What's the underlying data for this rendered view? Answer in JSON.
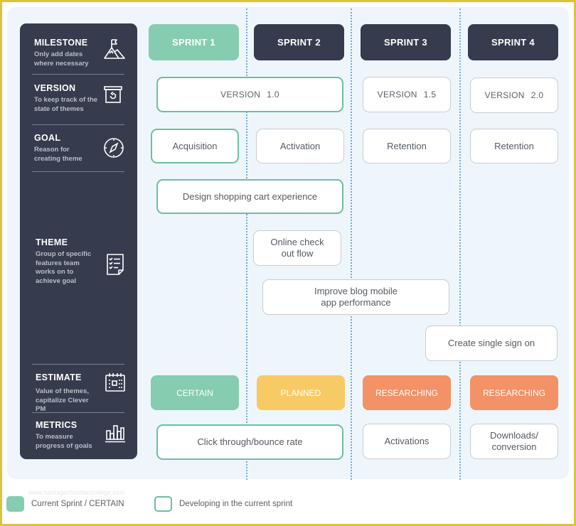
{
  "colors": {
    "sidebar_bg": "#363c4e",
    "current_green": "#86ccb0",
    "current_border": "#6dbf9c",
    "planned_yellow": "#f7ca65",
    "researching_orange": "#f39167",
    "canvas_bg": "#eef6fc",
    "frame_yellow": "#e0c23a"
  },
  "sidebar": {
    "sections": [
      {
        "title": "MILESTONE",
        "desc": "Only add dates where necessary",
        "icon": "mountain-flag-icon"
      },
      {
        "title": "VERSION",
        "desc": "To keep track of the state of themes",
        "icon": "archive-restore-icon"
      },
      {
        "title": "GOAL",
        "desc": "Reason for creating theme",
        "icon": "compass-icon"
      },
      {
        "title": "THEME",
        "desc": "Group of specific features team works on to achieve goal",
        "icon": "checklist-icon"
      },
      {
        "title": "ESTIMATE",
        "desc": "Value of themes, capitalize Clever PM",
        "icon": "calendar-icon"
      },
      {
        "title": "METRICS",
        "desc": "To measure progress of goals",
        "icon": "bar-chart-icon"
      }
    ]
  },
  "sprints": [
    {
      "label": "SPRINT 1",
      "current": true
    },
    {
      "label": "SPRINT 2",
      "current": false
    },
    {
      "label": "SPRINT 3",
      "current": false
    },
    {
      "label": "SPRINT 4",
      "current": false
    }
  ],
  "versions": [
    {
      "label": "VERSION",
      "number": "1.0",
      "span": "Sprint 1–2",
      "current": true
    },
    {
      "label": "VERSION",
      "number": "1.5",
      "span": "Sprint 3",
      "current": false
    },
    {
      "label": "VERSION",
      "number": "2.0",
      "span": "Sprint 4",
      "current": false
    }
  ],
  "goals": [
    {
      "text": "Acquisition",
      "sprint": 1,
      "current": true
    },
    {
      "text": "Activation",
      "sprint": 2,
      "current": false
    },
    {
      "text": "Retention",
      "sprint": 3,
      "current": false
    },
    {
      "text": "Retention",
      "sprint": 4,
      "current": false
    }
  ],
  "themes": [
    {
      "text": "Design shopping cart experience",
      "current": true
    },
    {
      "text": "Online check out flow",
      "current": false
    },
    {
      "text": "Improve blog mobile app performance",
      "current": false
    },
    {
      "text": "Create single sign on",
      "current": false
    }
  ],
  "estimates": [
    {
      "text": "CERTAIN",
      "status": "certain"
    },
    {
      "text": "PLANNED",
      "status": "planned"
    },
    {
      "text": "RESEARCHING",
      "status": "researching"
    },
    {
      "text": "RESEARCHING",
      "status": "researching"
    }
  ],
  "metrics": [
    {
      "text": "Click through/bounce rate",
      "current": true
    },
    {
      "text": "Activations",
      "current": false
    },
    {
      "text": "Downloads/ conversion",
      "current": false
    }
  ],
  "legend": [
    {
      "label": "Current Sprint / CERTAIN",
      "style": "filled"
    },
    {
      "label": "Developing in the current sprint",
      "style": "outlined"
    }
  ],
  "watermark": "www.heritagechristiancollege.com"
}
